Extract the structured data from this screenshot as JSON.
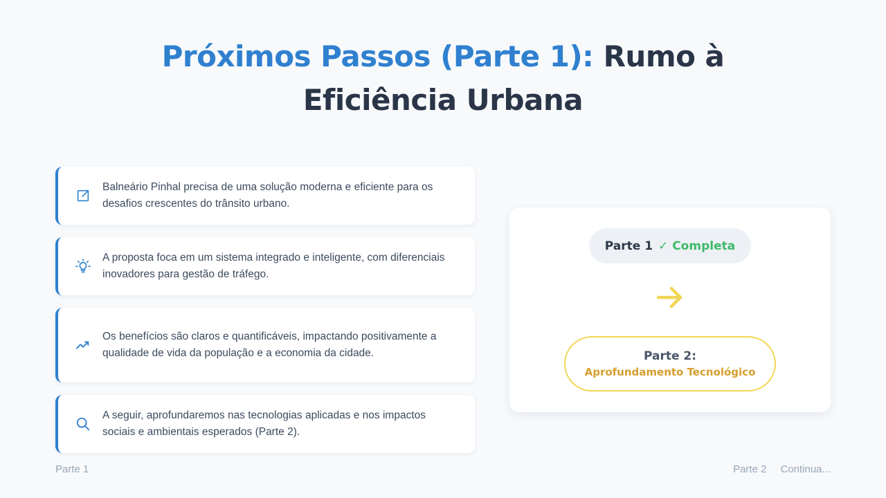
{
  "title": {
    "accent": "Próximos Passos (Parte 1):",
    "main": "Rumo à Eficiência Urbana"
  },
  "cards": [
    {
      "icon": "external-link-icon",
      "text": "Balneário Pinhal precisa de uma solução moderna e eficiente para os desafios crescentes do trânsito urbano."
    },
    {
      "icon": "lightbulb-icon",
      "text": "A proposta foca em um sistema integrado e inteligente, com diferenciais inovadores para gestão de tráfego."
    },
    {
      "icon": "trending-up-icon",
      "text": "Os benefícios são claros e quantificáveis, impactando positivamente a qualidade de vida da população e a economia da cidade."
    },
    {
      "icon": "search-icon",
      "text": "A seguir, aprofundaremos nas tecnologias aplicadas e nos impactos sociais e ambientais esperados (Parte 2)."
    }
  ],
  "progress": {
    "part1_label": "Parte 1",
    "part1_status": "✓ Completa",
    "part2_label": "Parte 2:",
    "part2_subtitle": "Aprofundamento Tecnológico"
  },
  "footer": {
    "left": "Parte 1",
    "right_part": "Parte 2",
    "right_continue": "Continua..."
  },
  "colors": {
    "accent": "#2f80cf",
    "complete": "#3fb86a",
    "next": "#f1d555",
    "next_text": "#d69e2e"
  }
}
